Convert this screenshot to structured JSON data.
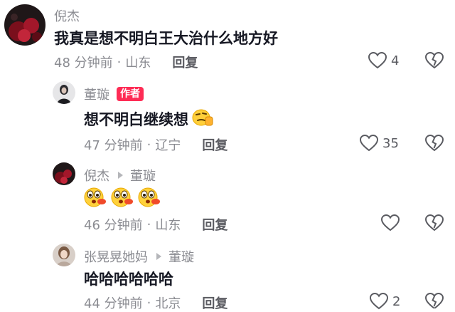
{
  "comments": [
    {
      "username": "倪杰",
      "text": "我真是想不明白王大治什么地方好",
      "time": "48 分钟前",
      "location": "山东",
      "reply_label": "回复",
      "likes": "4"
    },
    {
      "username": "董璇",
      "badge": "作者",
      "text": "想不明白继续想",
      "time": "47 分钟前",
      "location": "辽宁",
      "reply_label": "回复",
      "likes": "35"
    },
    {
      "username": "倪杰",
      "reply_to": "董璇",
      "text": "",
      "time": "46 分钟前",
      "location": "山东",
      "reply_label": "回复",
      "likes": ""
    },
    {
      "username": "张晃晃她妈",
      "reply_to": "董璇",
      "text": "哈哈哈哈哈哈",
      "time": "44 分钟前",
      "location": "北京",
      "reply_label": "回复",
      "likes": "2"
    }
  ],
  "separator": "·",
  "colors": {
    "text": "#161823",
    "secondary": "#8a8b91",
    "badge": "#fe2c55"
  }
}
